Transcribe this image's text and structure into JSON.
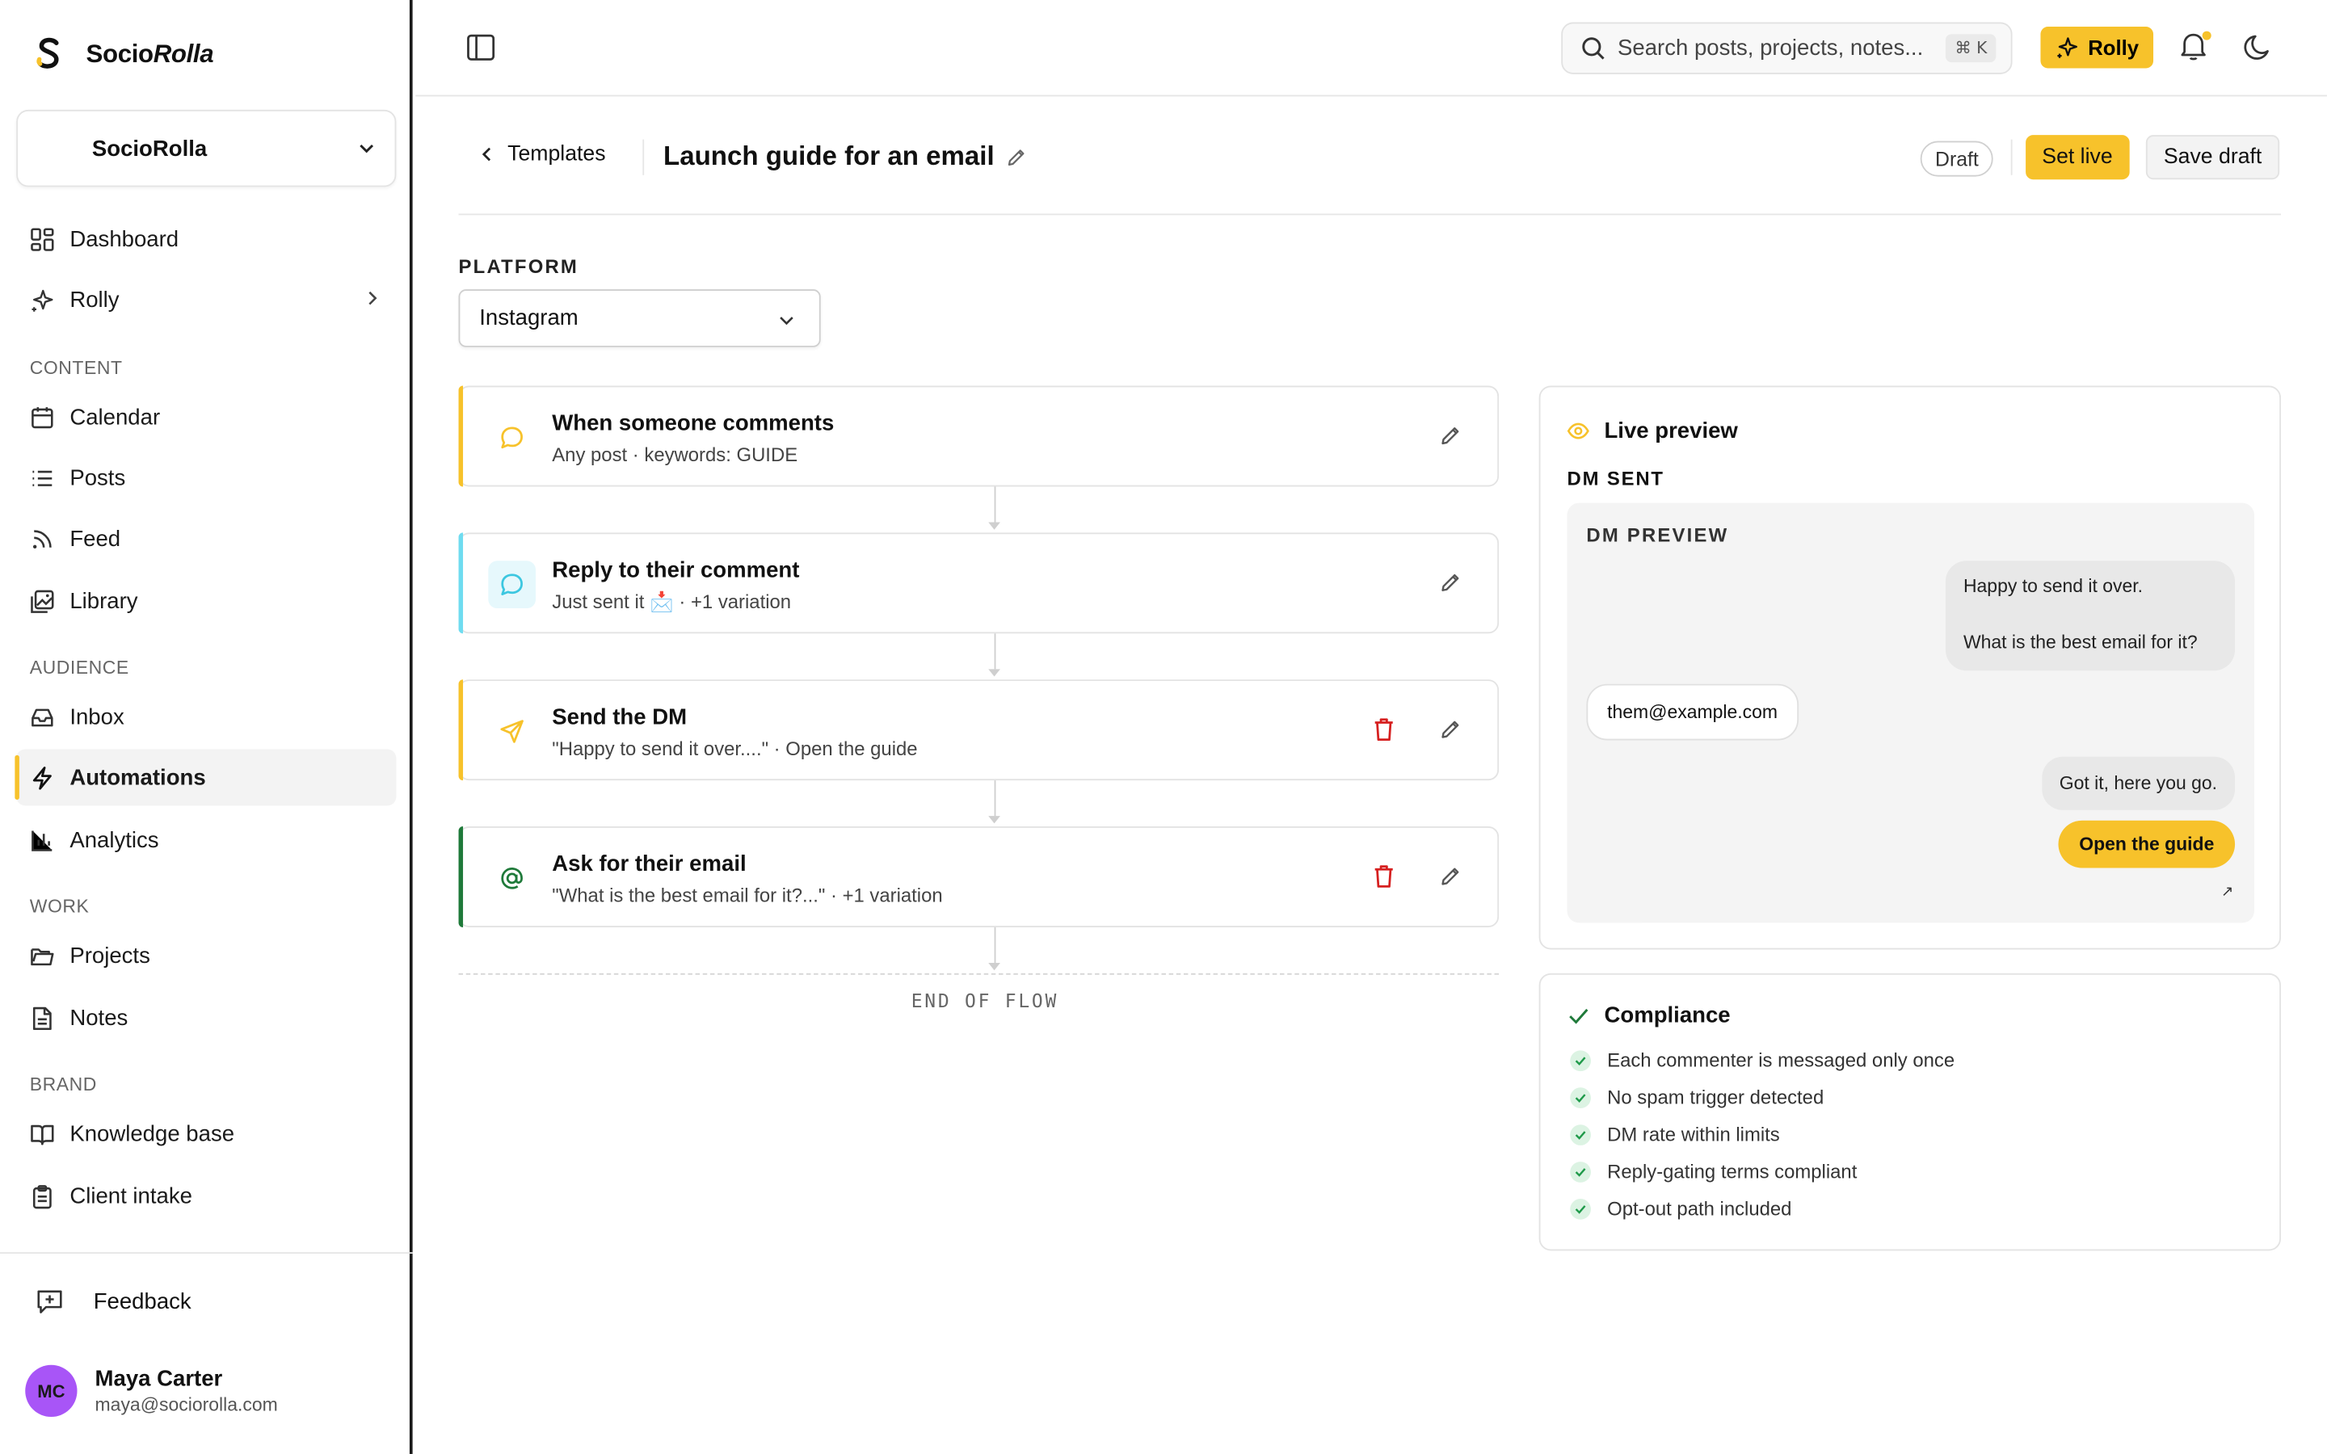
{
  "brand": {
    "name_plain": "Socio",
    "name_italic": "Rolla"
  },
  "workspace": {
    "name": "SocioRolla"
  },
  "nav": {
    "dashboard": "Dashboard",
    "rolly": "Rolly",
    "content_label": "CONTENT",
    "calendar": "Calendar",
    "posts": "Posts",
    "feed": "Feed",
    "library": "Library",
    "audience_label": "AUDIENCE",
    "inbox": "Inbox",
    "automations": "Automations",
    "analytics": "Analytics",
    "work_label": "WORK",
    "projects": "Projects",
    "notes": "Notes",
    "brand_label": "BRAND",
    "knowledge_base": "Knowledge base",
    "client_intake": "Client intake",
    "feedback": "Feedback"
  },
  "user": {
    "initials": "MC",
    "name": "Maya Carter",
    "email": "maya@sociorolla.com"
  },
  "topbar": {
    "search_placeholder": "Search posts, projects, notes...",
    "shortcut": "⌘ K",
    "rolly_label": "Rolly"
  },
  "header": {
    "back_label": "Templates",
    "title": "Launch guide for an email",
    "status": "Draft",
    "set_live": "Set live",
    "save_draft": "Save draft"
  },
  "platform": {
    "label": "PLATFORM",
    "value": "Instagram"
  },
  "flow": {
    "steps": [
      {
        "title": "When someone comments",
        "sub": "Any post · keywords: GUIDE"
      },
      {
        "title": "Reply to their comment",
        "sub": "Just sent it 📩 · +1 variation"
      },
      {
        "title": "Send the DM",
        "sub": "\"Happy to send it over....\" · Open the guide"
      },
      {
        "title": "Ask for their email",
        "sub": "\"What is the best email for it?...\" · +1 variation"
      }
    ],
    "end_label": "END OF FLOW"
  },
  "preview": {
    "title": "Live preview",
    "subtitle": "DM SENT",
    "dm_label": "DM PREVIEW",
    "msg1_line1": "Happy to send it over.",
    "msg1_line2": "What is the best email for it?",
    "reply": "them@example.com",
    "msg2": "Got it, here you go.",
    "button": "Open the guide",
    "ext_icon": "↗"
  },
  "compliance": {
    "title": "Compliance",
    "items": [
      "Each commenter is messaged only once",
      "No spam trigger detected",
      "DM rate within limits",
      "Reply-gating terms compliant",
      "Opt-out path included"
    ]
  },
  "colors": {
    "accent": "#f7c22b",
    "trash": "#d62020",
    "ask_accent": "#1f7a3a",
    "reply_accent": "#6fdcf0"
  },
  "icons": {
    "logo": "sociorolla-logo-icon",
    "nav": [
      "dashboard-icon",
      "sparkle-icon",
      "calendar-icon",
      "list-icon",
      "rss-icon",
      "image-icon",
      "inbox-icon",
      "bolt-icon",
      "bar-chart-icon",
      "folder-icon",
      "note-icon",
      "book-icon",
      "clipboard-icon",
      "feedback-icon"
    ],
    "topbar": [
      "sidebar-toggle-icon",
      "search-icon",
      "sparkle-icon",
      "bell-icon",
      "moon-icon"
    ]
  }
}
